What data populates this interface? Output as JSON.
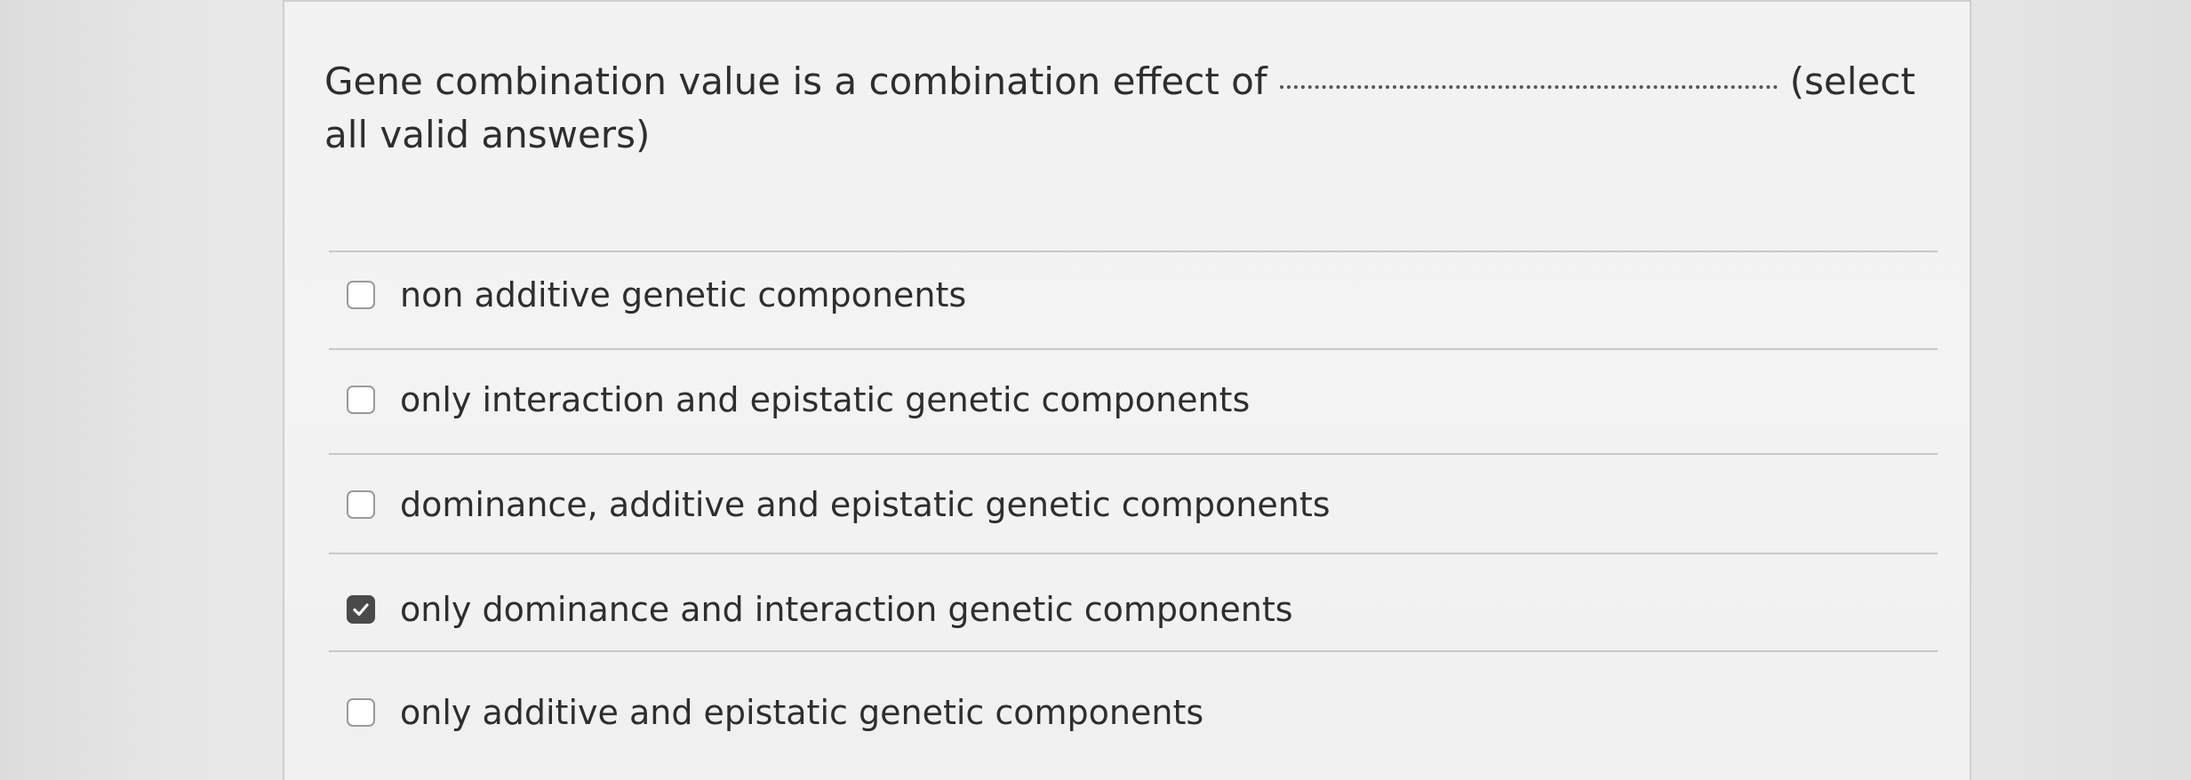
{
  "question": {
    "text": "Gene combination value is  a combination effect of",
    "suffix": "(select all valid answers)"
  },
  "options": [
    {
      "label": "non additive genetic components",
      "checked": false
    },
    {
      "label": "only interaction and epistatic genetic components",
      "checked": false
    },
    {
      "label": "dominance, additive and epistatic genetic components",
      "checked": false
    },
    {
      "label": "only dominance and interaction genetic components",
      "checked": true
    },
    {
      "label": "only additive and epistatic genetic components",
      "checked": false
    }
  ],
  "colors": {
    "checked_fill": "#4a4a4a",
    "text": "#2e2e2e",
    "divider": "#c8c8c8"
  },
  "icons": {
    "checked": "checkmark-icon"
  }
}
